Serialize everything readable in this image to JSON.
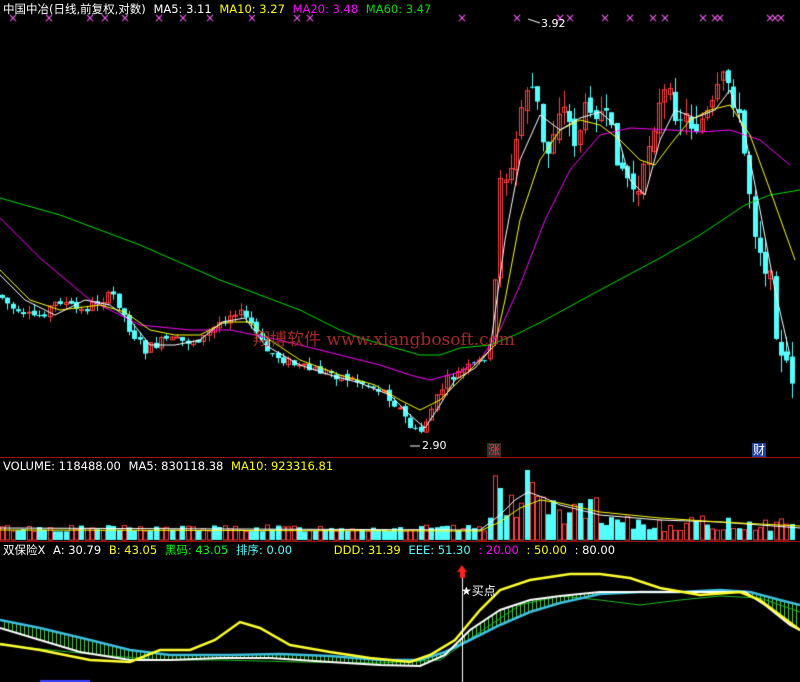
{
  "colors": {
    "up": "#ff4040",
    "down": "#54ffff",
    "ma5": "#ffffff",
    "ma10": "#ffff00",
    "ma20": "#ff00ff",
    "ma60": "#00e000",
    "label_white": "#ffffff",
    "panel_border": "#a01010",
    "marker_magenta": "#ff60ff",
    "buy_arrow": "#ff2020"
  },
  "price_panel": {
    "title": "中国中冶(日线,前复权,对数)",
    "ma5_label": "MA5: 3.11",
    "ma10_label": "MA10: 3.27",
    "ma20_label": "MA20: 3.48",
    "ma60_label": "MA60: 3.47",
    "high_mark": "3.92",
    "low_mark": "2.90",
    "watermark": "翔博软件 www.xiangbosoft.com",
    "tag_zhang": "涨",
    "tag_cai": "财",
    "top_marker": "×"
  },
  "volume_panel": {
    "volume_label": "VOLUME: 118488.00",
    "ma5_label": "MA5: 830118.38",
    "ma10_label": "MA10: 923316.81"
  },
  "indicator_panel": {
    "name": "双保险X",
    "a_label": "A: 30.79",
    "b_label": "B: 43.05",
    "heima_label": "黑码: 43.05",
    "paixu_label": "排序: 0.00",
    "ddd_label": "DDD: 31.39",
    "eee_label": "EEE: 51.30",
    "l20": ": 20.00",
    "l50": ": 50.00",
    "l80": ": 80.00",
    "buy_point": "★买点"
  },
  "chart_data": {
    "type": "candlestick",
    "scale": "log",
    "ma_values": {
      "MA5": 3.11,
      "MA10": 3.27,
      "MA20": 3.48,
      "MA60": 3.47
    },
    "annotated_high": 3.92,
    "annotated_low": 2.9,
    "volume": {
      "last": 118488.0,
      "MA5": 830118.38,
      "MA10": 923316.81
    },
    "indicator": {
      "A": 30.79,
      "B": 43.05,
      "黑码": 43.05,
      "排序": 0.0,
      "DDD": 31.39,
      "EEE": 51.3,
      "levels": [
        20.0,
        50.0,
        80.0
      ]
    }
  }
}
